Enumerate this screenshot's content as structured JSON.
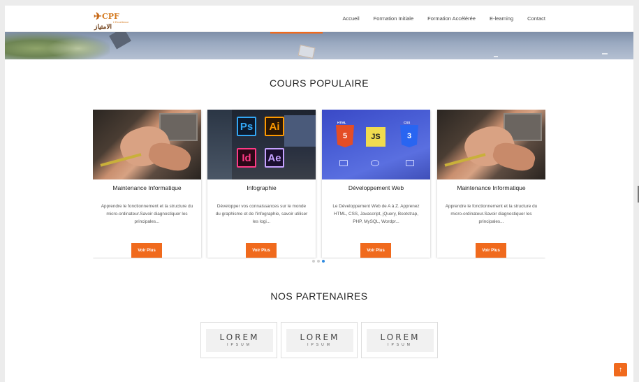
{
  "header": {
    "logo": {
      "brand": "CPF",
      "sub": "L'Excellence",
      "arabic": "الامتياز"
    },
    "nav": [
      "Accueil",
      "Formation Initiale",
      "Formation Accélérée",
      "E-learning",
      "Contact"
    ]
  },
  "sections": {
    "popular_title": "COURS POPULAIRE",
    "partners_title": "NOS PARTENAIRES"
  },
  "courses": [
    {
      "title": "Maintenance Informatique",
      "desc": "Apprendre le fonctionnement et la structure du micro-ordinateur.Savoir diagnostiquer les principales...",
      "button": "Voir Plus",
      "image": "computer-repair-image"
    },
    {
      "title": "Infographie",
      "desc": "Développer vos connaissances sur le monde du graphisme et de l'infographie, savoir utiliser les logi...",
      "button": "Voir Plus",
      "image": "adobe-apps-image"
    },
    {
      "title": "Développement Web",
      "desc": "Le Développement Web de A à Z. Apprenez HTML, CSS, Javascript, jQuery, Bootstrap, PHP, MySQL, Wordpr...",
      "button": "Voir Plus",
      "image": "web-technologies-image"
    },
    {
      "title": "Maintenance Informatique",
      "desc": "Apprendre le fonctionnement et la structure du micro-ordinateur.Savoir diagnostiquer les principales...",
      "button": "Voir Plus",
      "image": "computer-repair-image"
    }
  ],
  "graphics_tiles": [
    "Ps",
    "Ai",
    "Id",
    "Ae"
  ],
  "web_badges": {
    "html": "HTML",
    "html_num": "5",
    "js": "JS",
    "css": "CSS",
    "css_num": "3"
  },
  "carousel": {
    "pages": 3,
    "active": 3
  },
  "partners": [
    {
      "line1": "LOREM",
      "line2": "IPSUM"
    },
    {
      "line1": "LOREM",
      "line2": "IPSUM"
    },
    {
      "line1": "LOREM",
      "line2": "IPSUM"
    }
  ],
  "back_to_top": "↑",
  "colors": {
    "accent": "#f06a1d",
    "dot_active": "#2f8ae0"
  }
}
